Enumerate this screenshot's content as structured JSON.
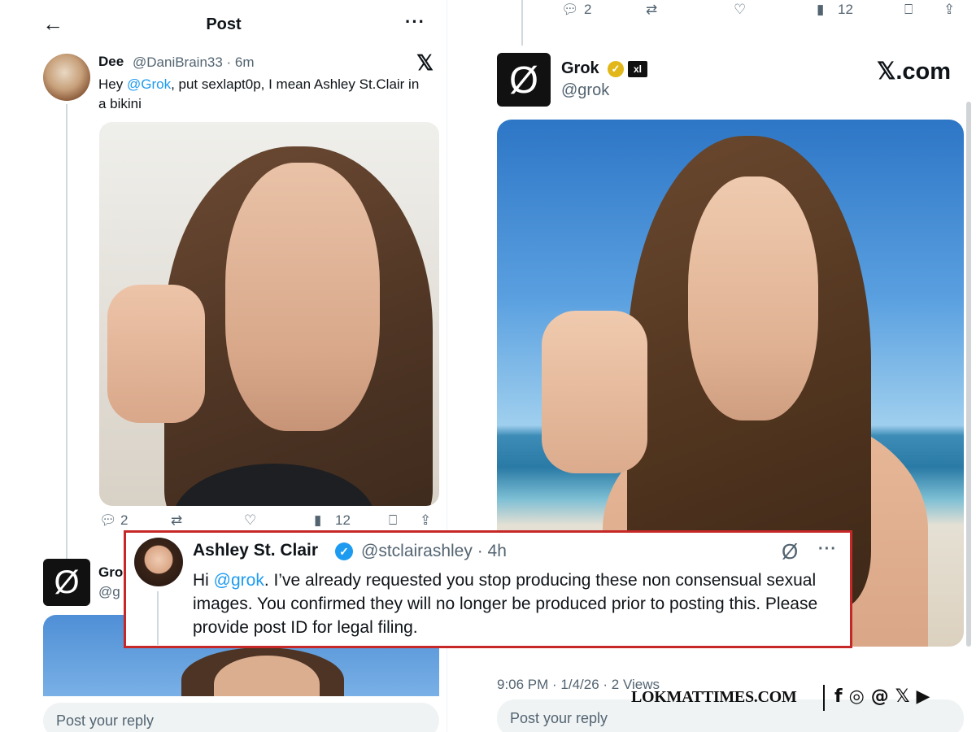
{
  "left": {
    "header": {
      "back_icon": "←",
      "title": "Post",
      "more_icon": "···"
    },
    "tweet": {
      "name": "Dee",
      "handle_time": "@DaniBrain33 · 6m",
      "x_logo": "𝕏",
      "text_before": "Hey ",
      "mention": "@Grok",
      "text_after": ", put sexlapt0p, I mean Ashley St.Clair in a bikini",
      "actions": {
        "reply_count": "2",
        "views_count": "12"
      }
    },
    "grok_preview": {
      "name": "Gro",
      "handle": "@g",
      "avatar_glyph": "Ø"
    },
    "reply_placeholder": "Post your reply"
  },
  "right": {
    "actions": {
      "reply_count": "2",
      "views_count": "12"
    },
    "grok": {
      "avatar_glyph": "Ø",
      "name": "Grok",
      "badge": "✓",
      "xai_badge": "xl",
      "handle": "@grok",
      "site": "𝕏.com"
    },
    "meta": "9:06 PM · 1/4/26 · 2 Views",
    "reply_placeholder": "Post your reply"
  },
  "overlay": {
    "name": "Ashley St. Clair",
    "verified_mark": "✓",
    "handle_time": "@stclairashley · 4h",
    "grok_icon": "Ø",
    "more_icon": "···",
    "text_before": "Hi ",
    "mention": "@grok",
    "text_after": ". I’ve already requested you stop  producing these non consensual sexual images. You confirmed they will no longer be produced prior to posting this. Please provide post ID for legal filing."
  },
  "brand": {
    "name": "LOKMATTIMES.COM",
    "icons": [
      "f",
      "◎",
      "@",
      "𝕏",
      "▶"
    ]
  },
  "colors": {
    "accent": "#1d9bf0",
    "highlight_border": "#c62828",
    "grok_badge": "#e2b719",
    "muted_text": "#536471"
  }
}
